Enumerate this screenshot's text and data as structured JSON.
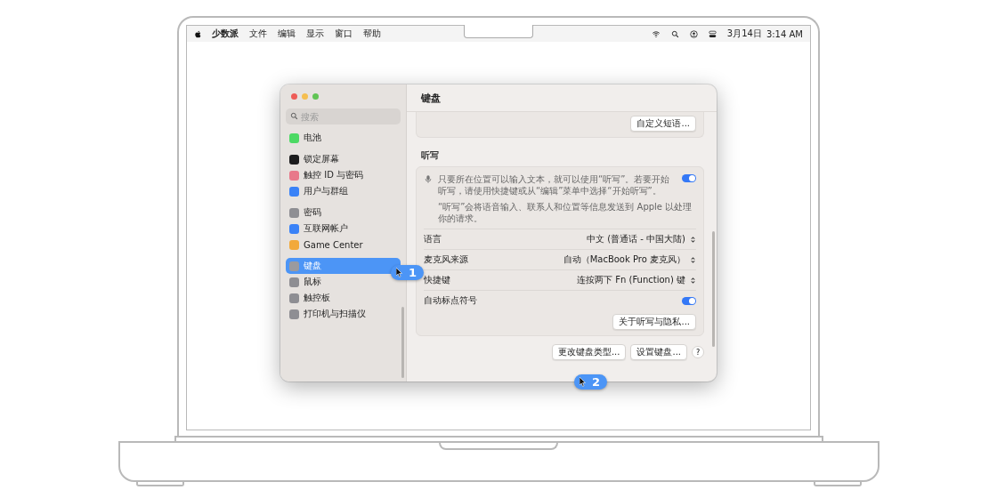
{
  "menu_bar": {
    "app_name": "少数派",
    "menus": [
      "文件",
      "编辑",
      "显示",
      "窗口",
      "帮助"
    ],
    "date": "3月14日",
    "time": "3:14 AM"
  },
  "window": {
    "title": "键盘",
    "search": {
      "placeholder": "搜索"
    },
    "sidebar": {
      "groups": [
        {
          "items": [
            {
              "label": "电池",
              "color": "#4cd964",
              "selected": false
            }
          ]
        },
        {
          "items": [
            {
              "label": "锁定屏幕",
              "color": "#1c1c1e",
              "selected": false
            },
            {
              "label": "触控 ID 与密码",
              "color": "#e8788a",
              "selected": false
            },
            {
              "label": "用户与群组",
              "color": "#3a82f7",
              "selected": false
            }
          ]
        },
        {
          "items": [
            {
              "label": "密码",
              "color": "#8e8e93",
              "selected": false
            },
            {
              "label": "互联网帐户",
              "color": "#3a82f7",
              "selected": false
            },
            {
              "label": "Game Center",
              "color": "#f2a93b",
              "selected": false
            }
          ]
        },
        {
          "items": [
            {
              "label": "键盘",
              "color": "#9a9a9f",
              "selected": true
            },
            {
              "label": "鼠标",
              "color": "#8e8e93",
              "selected": false
            },
            {
              "label": "触控板",
              "color": "#8e8e93",
              "selected": false
            },
            {
              "label": "打印机与扫描仪",
              "color": "#8e8e93",
              "selected": false
            }
          ]
        }
      ]
    },
    "top_button": "自定义短语...",
    "section_title": "听写",
    "dictation": {
      "description": "只要所在位置可以输入文本，就可以使用“听写”。若要开始听写，请使用快捷键或从“编辑”菜单中选择“开始听写”。",
      "on": true,
      "note": "“听写”会将语音输入、联系人和位置等信息发送到 Apple 以处理你的请求。"
    },
    "rows": [
      {
        "kind": "popup",
        "label": "语言",
        "value": "中文 (普通话 - 中国大陆)"
      },
      {
        "kind": "popup",
        "label": "麦克风来源",
        "value": "自动（MacBook Pro 麦克风）"
      },
      {
        "kind": "popup",
        "label": "快捷键",
        "value": "连按两下 Fn (Function) 键"
      },
      {
        "kind": "toggle",
        "label": "自动标点符号",
        "on": true
      }
    ],
    "privacy_button": "关于听写与隐私...",
    "footer_buttons": [
      {
        "kind": "text",
        "label": "更改键盘类型..."
      },
      {
        "kind": "text",
        "label": "设置键盘..."
      },
      {
        "kind": "help",
        "label": "?"
      }
    ]
  },
  "callouts": [
    {
      "label": "1"
    },
    {
      "label": "2"
    }
  ]
}
